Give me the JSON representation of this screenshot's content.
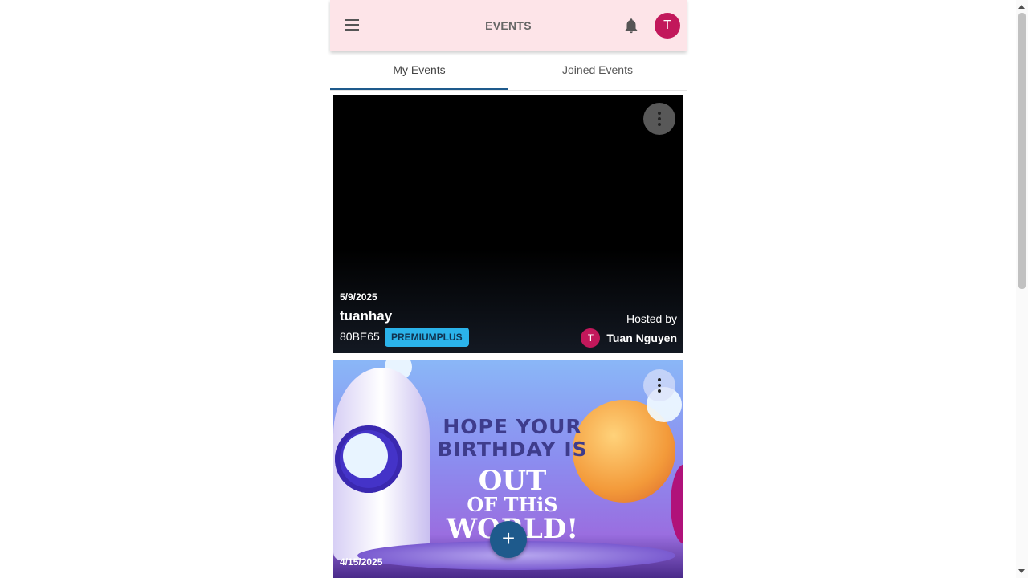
{
  "header": {
    "title": "EVENTS",
    "avatar_letter": "T"
  },
  "tabs": [
    {
      "label": "My Events",
      "active": true
    },
    {
      "label": "Joined Events",
      "active": false
    }
  ],
  "events": [
    {
      "date": "5/9/2025",
      "name": "tuanhay",
      "code": "80BE65",
      "plan": "PREMIUMPLUS",
      "hosted_by_label": "Hosted by",
      "host_avatar_letter": "T",
      "host_name": "Tuan Nguyen"
    },
    {
      "date": "4/15/2025",
      "image_text": {
        "line1": "HOPE YOUR",
        "line2": "BIRTHDAY IS",
        "line3": "OUT",
        "line4": "OF THiS",
        "line5": "WORLD!"
      }
    }
  ],
  "fab_symbol": "+",
  "colors": {
    "header_bg": "#fde4e8",
    "accent": "#1e5a8c",
    "avatar": "#c2185b",
    "badge": "#2bb3ea"
  }
}
